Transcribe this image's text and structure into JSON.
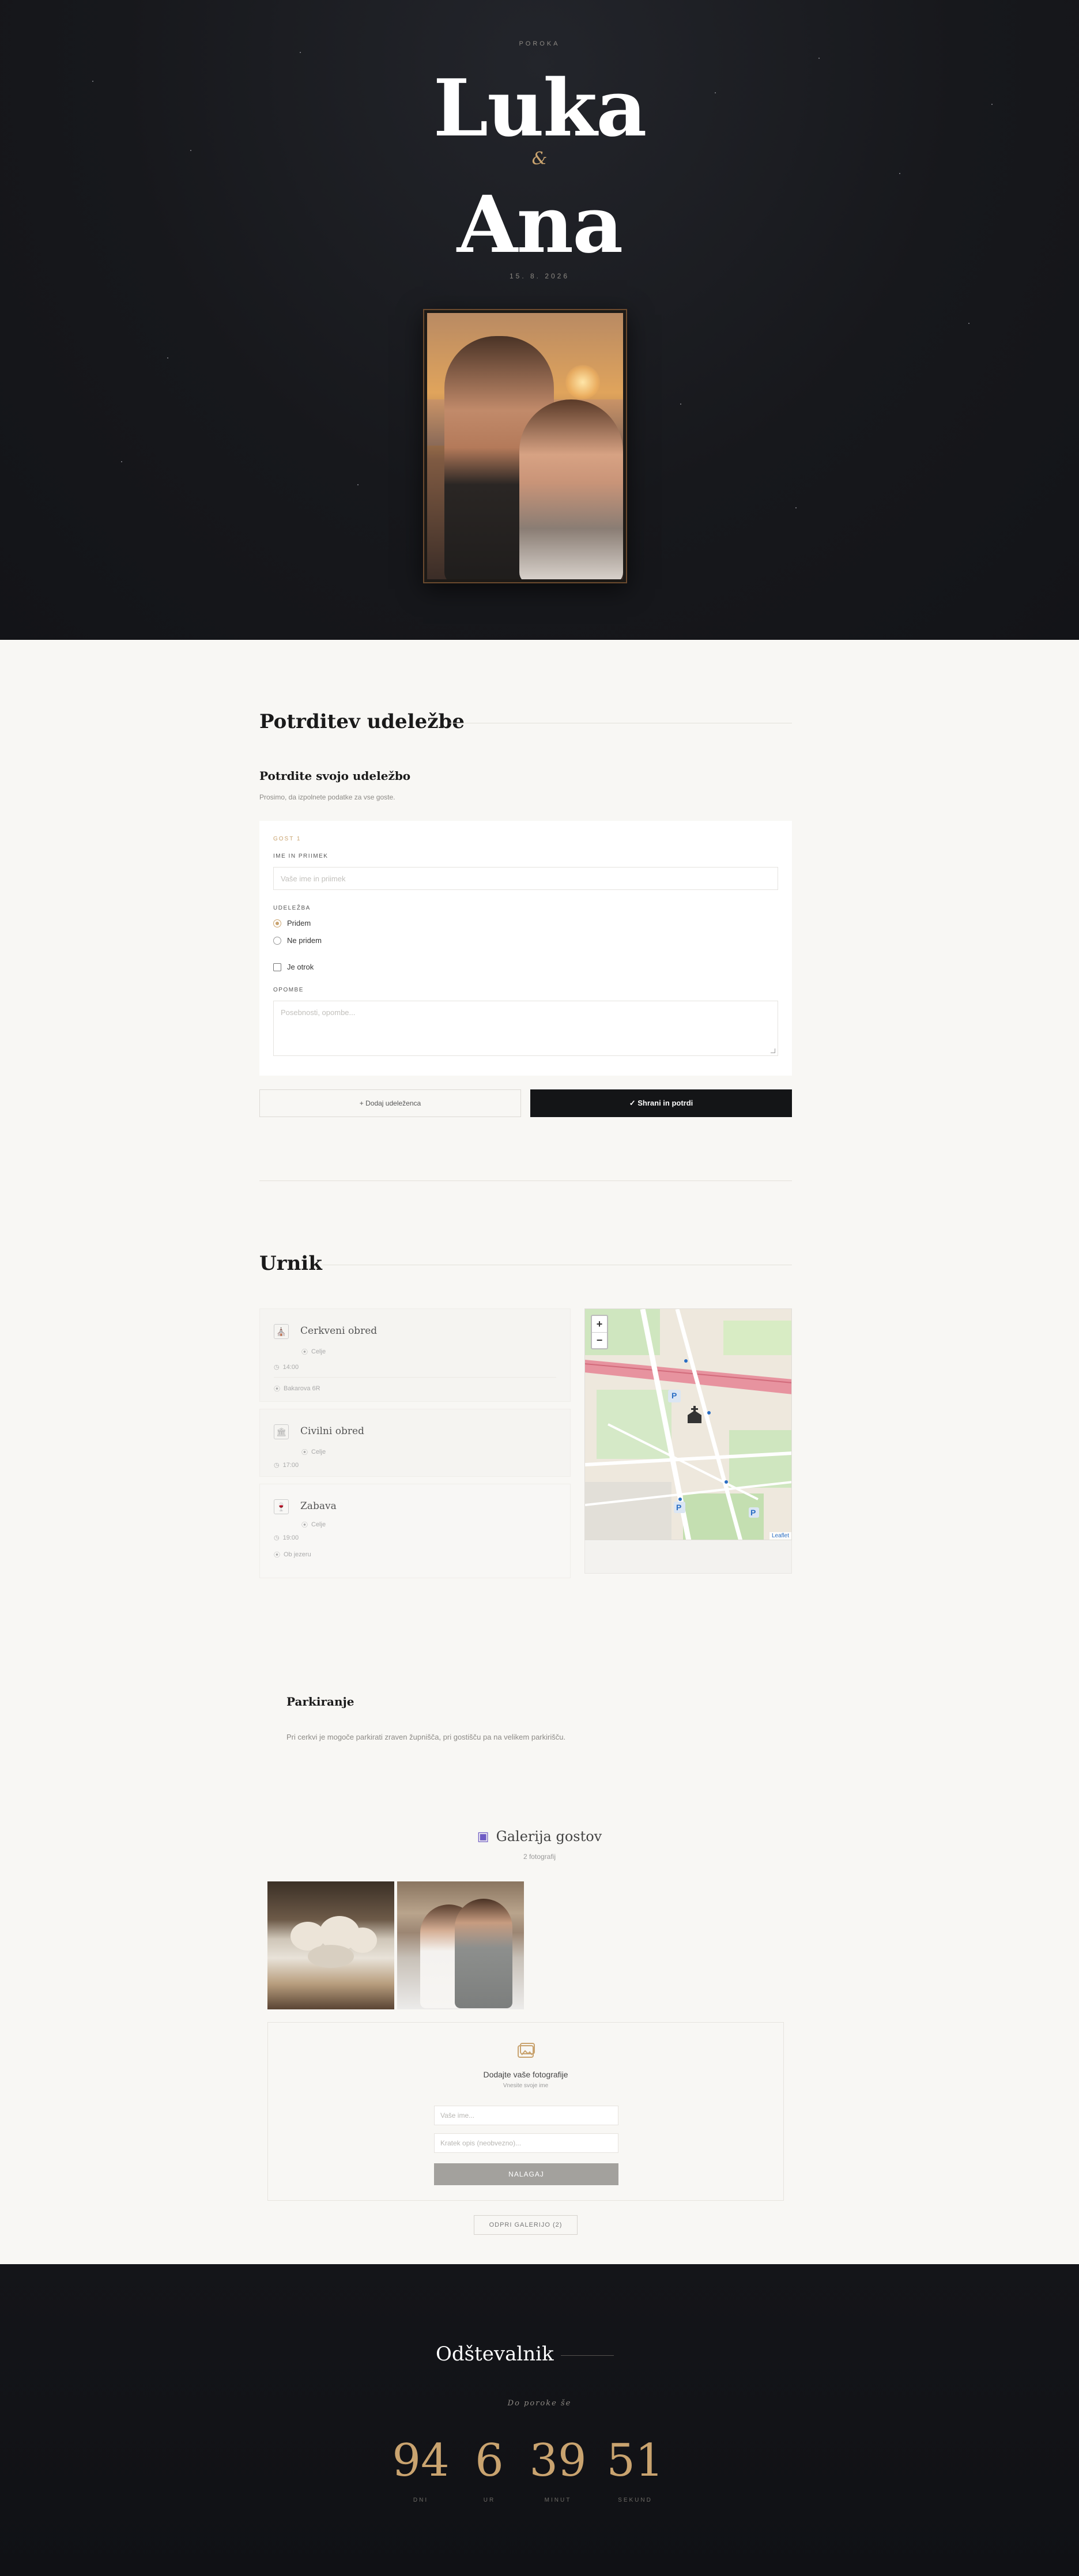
{
  "hero": {
    "kicker": "POROKA",
    "name1": "Luka",
    "amp": "&",
    "name2": "Ana",
    "date": "15. 8. 2026"
  },
  "rsvp": {
    "section_title": "Potrditev udeležbe",
    "subtitle": "Potrdite svojo udeležbo",
    "description": "Prosimo, da izpolnete podatke za vse goste.",
    "guest_label": "GOST 1",
    "name_label": "IME IN PRIIMEK",
    "name_placeholder": "Vaše ime in priimek",
    "attendance_label": "UDELEŽBA",
    "option_yes": "Pridem",
    "option_no": "Ne pridem",
    "child_label": "Je otrok",
    "notes_label": "OPOMBE",
    "notes_placeholder": "Posebnosti, opombe...",
    "add_guest_label": "+ Dodaj udeleženca",
    "save_label": "✓  Shrani in potrdi"
  },
  "schedule": {
    "section_title": "Urnik",
    "events": [
      {
        "title": "Cerkveni obred",
        "location": "Celje",
        "time": "14:00",
        "address": "Bakarova 6R"
      },
      {
        "title": "Civilni obred",
        "location": "Celje",
        "time": "17:00"
      },
      {
        "title": "Zabava",
        "location": "Celje",
        "time": "19:00",
        "address": "Ob jezeru"
      }
    ],
    "map": {
      "zoom_in": "+",
      "zoom_out": "−",
      "attribution": "Leaflet",
      "parking_marker": "P"
    }
  },
  "parking": {
    "title": "Parkiranje",
    "text": "Pri cerkvi je mogoče parkirati zraven župnišča, pri gostišču pa na velikem parkirišču."
  },
  "gallery": {
    "title": "Galerija gostov",
    "count": "2 fotografij",
    "upload_title": "Dodajte vaše fotografije",
    "upload_sub": "Vnesite svoje ime",
    "name_placeholder": "Vaše ime...",
    "caption_placeholder": "Kratek opis (neobvezno)...",
    "upload_button": "NALAGAJ",
    "open_button": "ODPRI GALERIJO (2)"
  },
  "countdown": {
    "title": "Odštevalnik",
    "subtitle": "Do poroke še",
    "units": [
      {
        "value": "94",
        "label": "DNI"
      },
      {
        "value": "6",
        "label": "UR"
      },
      {
        "value": "39",
        "label": "MINUT"
      },
      {
        "value": "51",
        "label": "SEKUND"
      }
    ]
  },
  "colors": {
    "accent": "#c9a36f",
    "dark": "#141517",
    "cream": "#f8f7f4"
  }
}
